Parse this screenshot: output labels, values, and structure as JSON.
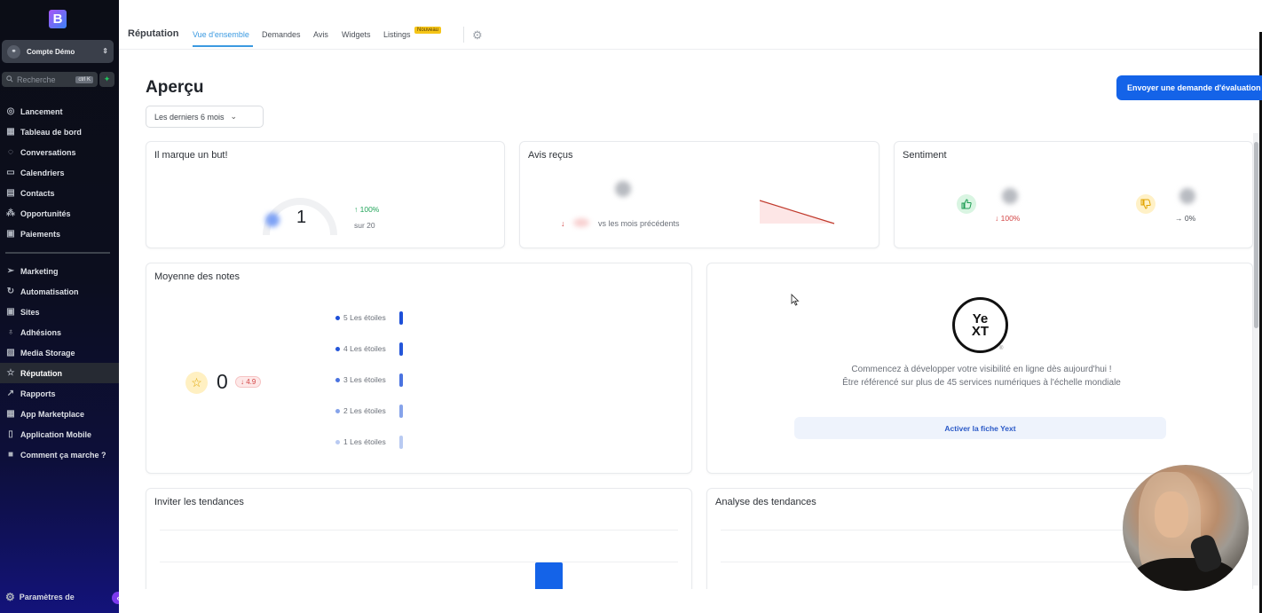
{
  "sidebar": {
    "logo_letter": "B",
    "account": {
      "name": "Compte Démo",
      "avatar_glyph": "⚭",
      "switch_glyph": "⇕"
    },
    "search": {
      "placeholder": "Recherche",
      "shortcut": "ctrl K",
      "icon": "search-icon"
    },
    "quick_action_icon": "✦",
    "items_top": [
      {
        "label": "Lancement",
        "icon": "◎"
      },
      {
        "label": "Tableau de bord",
        "icon": "▦"
      },
      {
        "label": "Conversations",
        "icon": "◌"
      },
      {
        "label": "Calendriers",
        "icon": "▭"
      },
      {
        "label": "Contacts",
        "icon": "▤"
      },
      {
        "label": "Opportunités",
        "icon": "⁂"
      },
      {
        "label": "Paiements",
        "icon": "▣"
      }
    ],
    "items_bottom": [
      {
        "label": "Marketing",
        "icon": "➢"
      },
      {
        "label": "Automatisation",
        "icon": "↻"
      },
      {
        "label": "Sites",
        "icon": "▣"
      },
      {
        "label": "Adhésions",
        "icon": "♁"
      },
      {
        "label": "Media Storage",
        "icon": "▨"
      },
      {
        "label": "Réputation",
        "icon": "☆",
        "active": true
      },
      {
        "label": "Rapports",
        "icon": "↗"
      },
      {
        "label": "App Marketplace",
        "icon": "▦"
      },
      {
        "label": "Application Mobile",
        "icon": "▯"
      },
      {
        "label": "Comment ça marche ?",
        "icon": "■"
      }
    ],
    "settings_label": "Paramètres de",
    "settings_icon": "⚙",
    "collapse_icon": "‹"
  },
  "topbar": {
    "section_title": "Réputation",
    "tabs": [
      {
        "label": "Vue d'ensemble",
        "active": true
      },
      {
        "label": "Demandes"
      },
      {
        "label": "Avis"
      },
      {
        "label": "Widgets"
      },
      {
        "label": "Listings"
      }
    ],
    "new_badge": "Nouveau",
    "settings_icon": "⚙"
  },
  "main": {
    "title": "Aperçu",
    "period_select": {
      "value": "Les derniers 6 mois",
      "chevron": "⌄"
    },
    "send_request_button": "Envoyer une demande d'évaluation",
    "goal_card": {
      "title": "Il marque un but!",
      "value": "1",
      "change": "↑ 100%",
      "target": "sur 20"
    },
    "reviews_card": {
      "title": "Avis reçus",
      "change_arrow": "↓",
      "comparison": "vs les mois précédents"
    },
    "sentiment_card": {
      "title": "Sentiment",
      "positive_icon": "👍",
      "positive_change": "↓ 100%",
      "negative_icon": "👎",
      "negative_change": "→ 0%"
    },
    "ratings_card": {
      "title": "Moyenne des notes",
      "star_icon": "☆",
      "average": "0",
      "change": "↓ 4.9",
      "rows": [
        {
          "label": "5 Les étoiles",
          "color": "#1d4fd8"
        },
        {
          "label": "4 Les étoiles",
          "color": "#2456d9"
        },
        {
          "label": "3 Les étoiles",
          "color": "#4a73e0"
        },
        {
          "label": "2 Les étoiles",
          "color": "#86a3ea"
        },
        {
          "label": "1 Les étoiles",
          "color": "#b9caf2"
        }
      ]
    },
    "yext_card": {
      "logo_line1": "Ye",
      "logo_line2": "XT",
      "registered": "®",
      "line1": "Commencez à développer votre visibilité en ligne dès aujourd'hui !",
      "line2": "Être référencé sur plus de 45 services numériques à l'échelle mondiale",
      "button": "Activer la fiche Yext"
    },
    "invite_trends_card": {
      "title": "Inviter les tendances"
    },
    "trend_analysis_card": {
      "title": "Analyse des tendances"
    }
  },
  "colors": {
    "accent": "#1463e8",
    "tab_active": "#3b9ae1",
    "positive": "#22a55a",
    "negative": "#d34545",
    "badge": "#f5c518"
  }
}
